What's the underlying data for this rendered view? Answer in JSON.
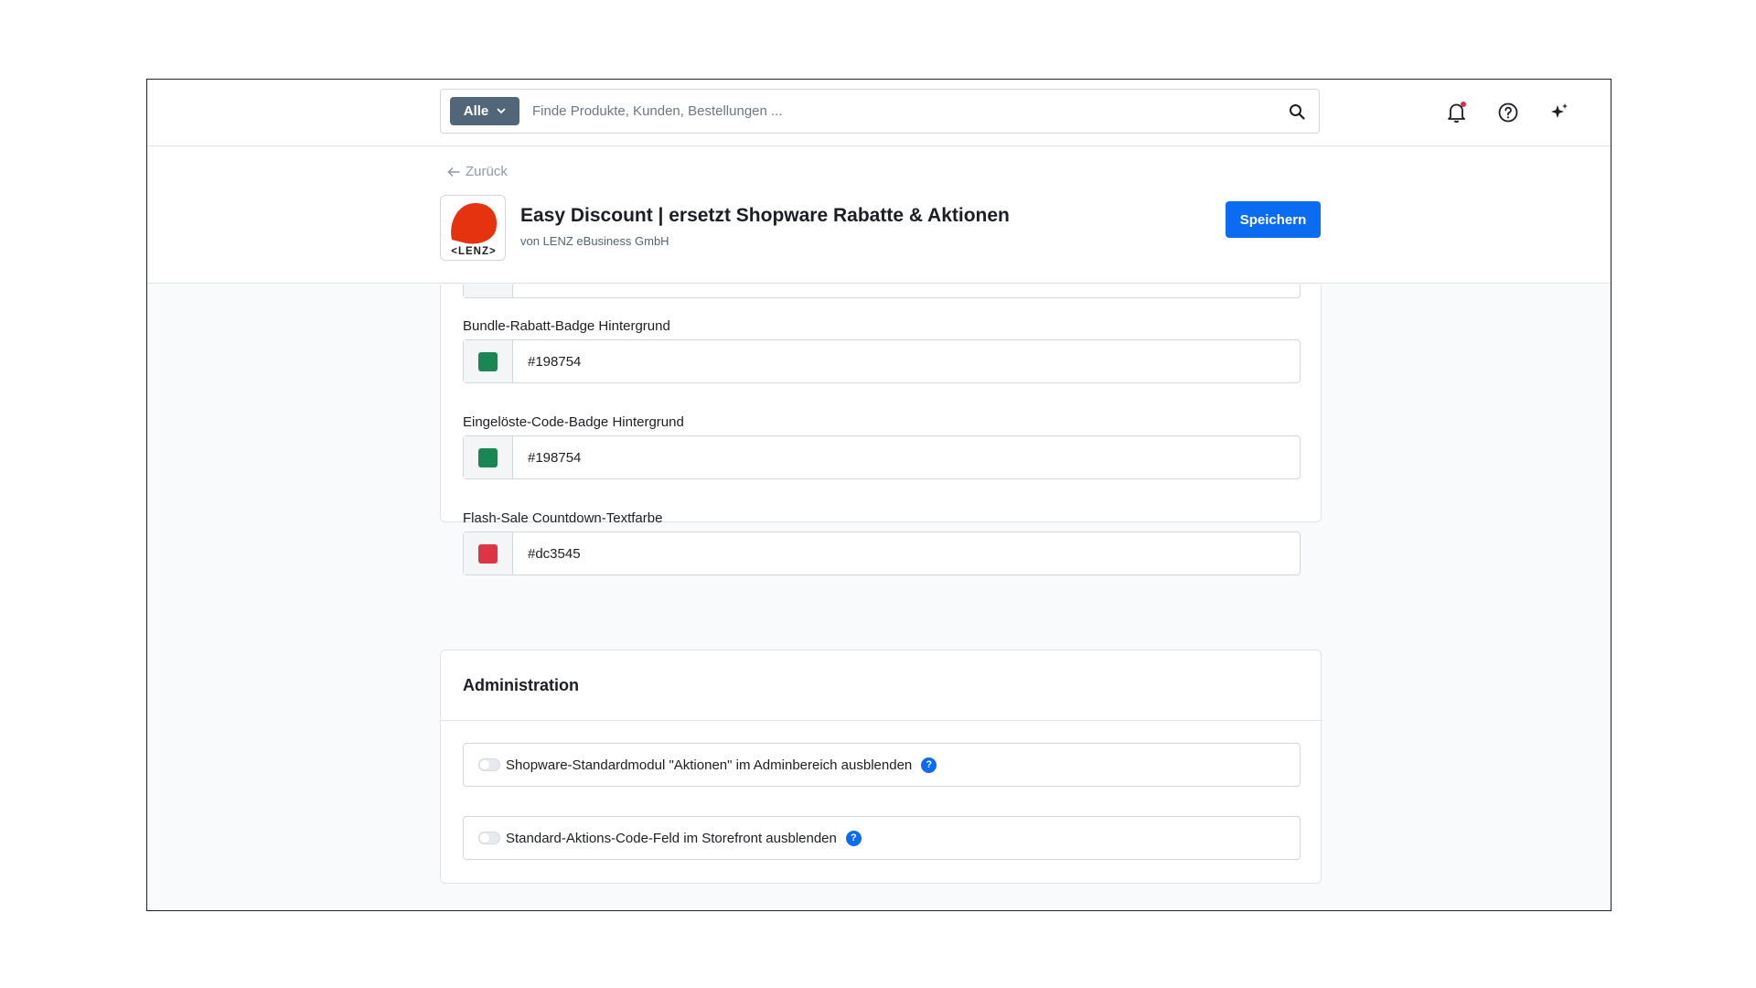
{
  "search": {
    "type_label": "Alle",
    "placeholder": "Finde Produkte, Kunden, Bestellungen ..."
  },
  "header": {
    "back_label": "Zurück",
    "title": "Easy Discount | ersetzt Shopware Rabatte & Aktionen",
    "subtitle": "von LENZ eBusiness GmbH",
    "logo_text": "<LENZ>",
    "save_label": "Speichern"
  },
  "colors": {
    "fields": [
      {
        "label": "Bundle-Rabatt-Badge Hintergrund",
        "value": "#198754",
        "swatch": "#198754"
      },
      {
        "label": "Eingelöste-Code-Badge Hintergrund",
        "value": "#198754",
        "swatch": "#198754"
      },
      {
        "label": "Flash-Sale Countdown-Textfarbe",
        "value": "#dc3545",
        "swatch": "#dc3545"
      }
    ]
  },
  "administration": {
    "title": "Administration",
    "toggles": [
      {
        "label": "Shopware-Standardmodul \"Aktionen\" im Adminbereich ausblenden",
        "checked": false
      },
      {
        "label": "Standard-Aktions-Code-Feld im Storefront ausblenden",
        "checked": false
      }
    ]
  },
  "theme": {
    "primary": "#0b6cf2",
    "notification_dot": "#de294c",
    "logo_red": "#e5320f"
  }
}
